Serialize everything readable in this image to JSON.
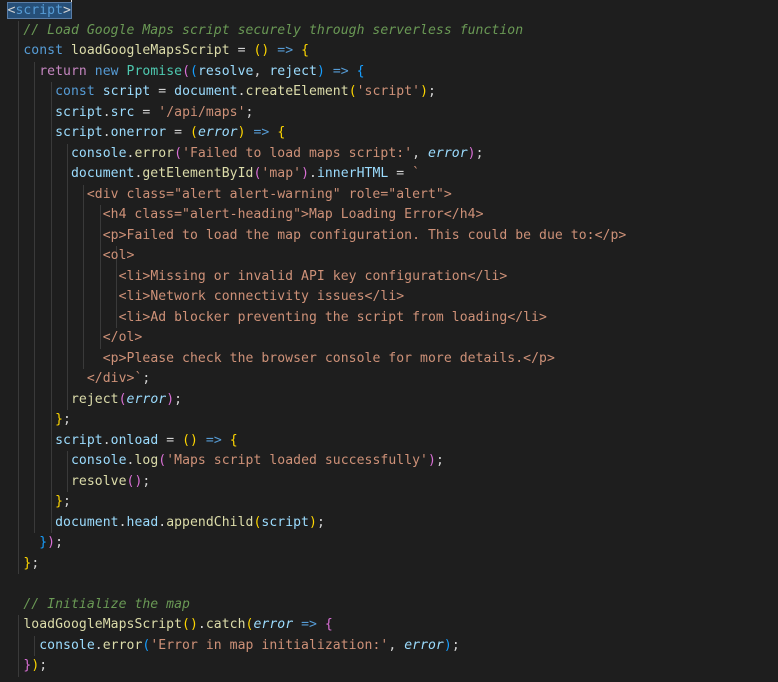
{
  "editor": {
    "language": "javascript",
    "lines": [
      "<script>",
      "  // Load Google Maps script securely through serverless function",
      "  const loadGoogleMapsScript = () => {",
      "    return new Promise((resolve, reject) => {",
      "      const script = document.createElement('script');",
      "      script.src = '/api/maps';",
      "      script.onerror = (error) => {",
      "        console.error('Failed to load maps script:', error);",
      "        document.getElementById('map').innerHTML = `",
      "          <div class=\"alert alert-warning\" role=\"alert\">",
      "            <h4 class=\"alert-heading\">Map Loading Error</h4>",
      "            <p>Failed to load the map configuration. This could be due to:</p>",
      "            <ol>",
      "              <li>Missing or invalid API key configuration</li>",
      "              <li>Network connectivity issues</li>",
      "              <li>Ad blocker preventing the script from loading</li>",
      "            </ol>",
      "            <p>Please check the browser console for more details.</p>",
      "          </div>`;",
      "        reject(error);",
      "      };",
      "      script.onload = () => {",
      "        console.log('Maps script loaded successfully');",
      "        resolve();",
      "      };",
      "      document.head.appendChild(script);",
      "    });",
      "  };",
      "",
      "  // Initialize the map",
      "  loadGoogleMapsScript().catch(error => {",
      "    console.error('Error in map initialization:', error);",
      "  });"
    ]
  }
}
